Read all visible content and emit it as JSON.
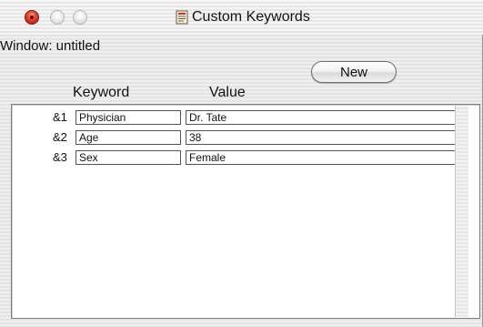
{
  "window": {
    "title": "Custom Keywords",
    "close_icon": "close-icon",
    "minimize_icon": "minimize-icon",
    "zoom_icon": "zoom-icon",
    "document_icon": "document-icon"
  },
  "window_label": "Window:  untitled",
  "new_button_label": "New",
  "columns": {
    "keyword": "Keyword",
    "value": "Value"
  },
  "rows": [
    {
      "index": "&1",
      "keyword": "Physician",
      "value": "Dr. Tate"
    },
    {
      "index": "&2",
      "keyword": "Age",
      "value": "38"
    },
    {
      "index": "&3",
      "keyword": "Sex",
      "value": "Female"
    }
  ],
  "colors": {
    "close_button": "#e0412c",
    "frame_border": "#7e7e7e",
    "cell_border": "#555555"
  }
}
